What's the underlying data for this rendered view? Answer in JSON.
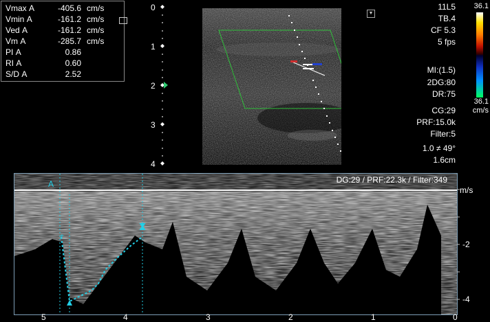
{
  "measurements": {
    "rows": [
      {
        "label": "Vmax",
        "tag": "A",
        "value": "-405.6",
        "unit": "cm/s"
      },
      {
        "label": "Vmin",
        "tag": "A",
        "value": "-161.2",
        "unit": "cm/s"
      },
      {
        "label": "Ved",
        "tag": "A",
        "value": "-161.2",
        "unit": "cm/s"
      },
      {
        "label": "Vm",
        "tag": "A",
        "value": "-285.7",
        "unit": "cm/s"
      },
      {
        "label": "PI",
        "tag": "A",
        "value": "0.86",
        "unit": ""
      },
      {
        "label": "RI",
        "tag": "A",
        "value": "0.60",
        "unit": ""
      },
      {
        "label": "S/D",
        "tag": "A",
        "value": "2.52",
        "unit": ""
      }
    ]
  },
  "depth_scale": {
    "labels": [
      "0",
      "1",
      "2",
      "3",
      "4"
    ]
  },
  "params": {
    "probe": "11L5",
    "ti": "TB.4",
    "cf": "CF 5.3",
    "fps": "5 fps",
    "mi": "MI:(1.5)",
    "dg2d": "2DG:80",
    "dr": "DR:75",
    "cg": "CG:29",
    "prf": "PRF:15.0k",
    "filter": "Filter:5",
    "angle": "1.0  ≠ 49°",
    "gate": "1.6cm"
  },
  "color_bar": {
    "top_value": "36.1",
    "bottom_value": "36.1",
    "unit": "cm/s",
    "colors": {
      "positive": "#ffe000",
      "negative": "#00ff60"
    }
  },
  "spectral": {
    "header": "DG:29 /   PRF:22.3k / Filter:349",
    "cursor_label": "A",
    "velocity_unit": "m/s",
    "velocity_ticks": [
      "-2",
      "-4"
    ],
    "time_ticks": [
      "5",
      "4",
      "3",
      "2",
      "1",
      "0"
    ],
    "trace_color": "#22d0e8"
  },
  "icons": {
    "marker": "triangle-marker-icon",
    "freeze": "freeze-icon"
  }
}
